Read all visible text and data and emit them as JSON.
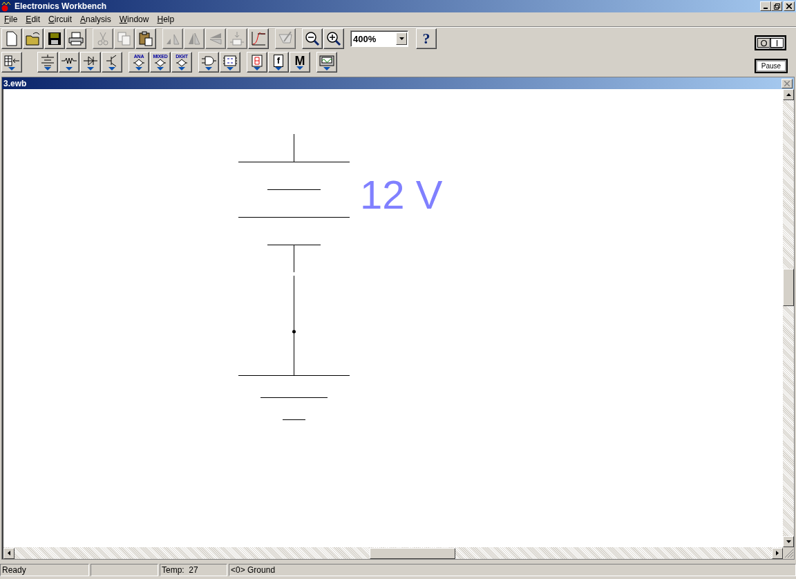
{
  "window": {
    "title": "Electronics Workbench"
  },
  "menu": [
    {
      "label": "File"
    },
    {
      "label": "Edit"
    },
    {
      "label": "Circuit"
    },
    {
      "label": "Analysis"
    },
    {
      "label": "Window"
    },
    {
      "label": "Help"
    }
  ],
  "toolbar": {
    "groups": [
      [
        {
          "kind": "new",
          "disabled": false
        },
        {
          "kind": "open",
          "disabled": false
        },
        {
          "kind": "save",
          "disabled": false
        },
        {
          "kind": "print",
          "disabled": false
        }
      ],
      [
        {
          "kind": "cut",
          "disabled": true
        },
        {
          "kind": "copy",
          "disabled": true
        },
        {
          "kind": "paste",
          "disabled": false
        }
      ],
      [
        {
          "kind": "rotate",
          "disabled": true
        },
        {
          "kind": "flip_horizontal",
          "disabled": true
        },
        {
          "kind": "flip_vertical",
          "disabled": true
        },
        {
          "kind": "subcircuit",
          "disabled": true
        },
        {
          "kind": "graph",
          "disabled": false
        }
      ],
      [
        {
          "kind": "properties",
          "disabled": true
        }
      ],
      [
        {
          "kind": "zoom_out",
          "disabled": false
        },
        {
          "kind": "zoom_in",
          "disabled": false
        }
      ]
    ],
    "zoom": {
      "value": "400%"
    },
    "help": {
      "label": "?"
    }
  },
  "parts_bins": {
    "groups": [
      [
        {
          "kind": "favorites"
        }
      ],
      [
        {
          "kind": "sources"
        },
        {
          "kind": "basic"
        },
        {
          "kind": "diodes"
        },
        {
          "kind": "transistors"
        }
      ],
      [
        {
          "kind": "analog_ics",
          "label": "ANA"
        },
        {
          "kind": "mixed_ics",
          "label": "MIXED"
        },
        {
          "kind": "digital_ics",
          "label": "DIGIT"
        }
      ],
      [
        {
          "kind": "logic_gates"
        },
        {
          "kind": "digital"
        }
      ],
      [
        {
          "kind": "indicators"
        },
        {
          "kind": "controls",
          "label": "f"
        },
        {
          "kind": "miscellaneous",
          "label": "M"
        }
      ],
      [
        {
          "kind": "instruments"
        }
      ]
    ]
  },
  "power_switch": {
    "off_label": "O",
    "on_label": "I",
    "on": false
  },
  "pause_button": {
    "label": "Pause"
  },
  "document": {
    "title": "3.ewb",
    "battery_label": "12 V"
  },
  "status_bar": {
    "message": "Ready",
    "temperature": "Temp:  27",
    "node": "<0> Ground"
  }
}
